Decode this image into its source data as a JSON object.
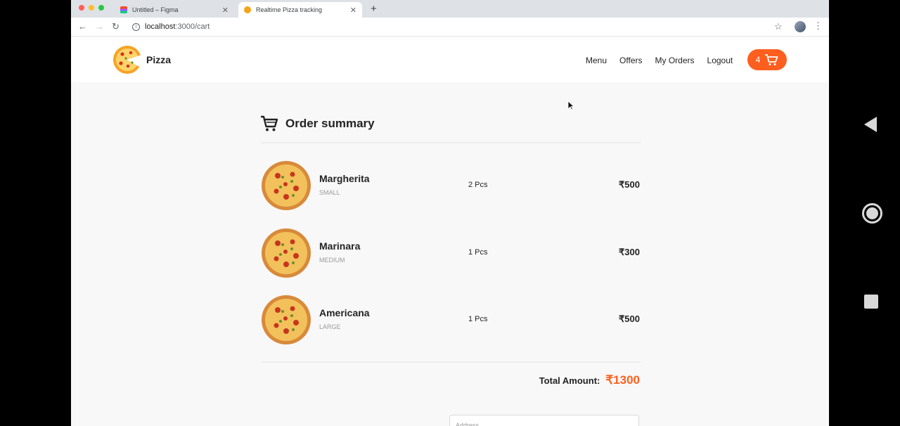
{
  "browser": {
    "tabs": [
      {
        "title": "Untitled – Figma",
        "active": false
      },
      {
        "title": "Realtime Pizza tracking",
        "active": true
      }
    ],
    "url": {
      "host": "localhost",
      "rest": ":3000/cart"
    }
  },
  "header": {
    "brand": "Pizza",
    "nav": [
      "Menu",
      "Offers",
      "My Orders",
      "Logout"
    ],
    "cart_count": "4"
  },
  "summary": {
    "title": "Order summary",
    "items": [
      {
        "name": "Margherita",
        "size": "SMALL",
        "qty": "2 Pcs",
        "price": "₹500"
      },
      {
        "name": "Marinara",
        "size": "MEDIUM",
        "qty": "1 Pcs",
        "price": "₹300"
      },
      {
        "name": "Americana",
        "size": "LARGE",
        "qty": "1 Pcs",
        "price": "₹500"
      }
    ],
    "total_label": "Total Amount:",
    "total_value": "₹1300",
    "address_placeholder": "Address"
  },
  "colors": {
    "accent": "#fe5f1e"
  }
}
